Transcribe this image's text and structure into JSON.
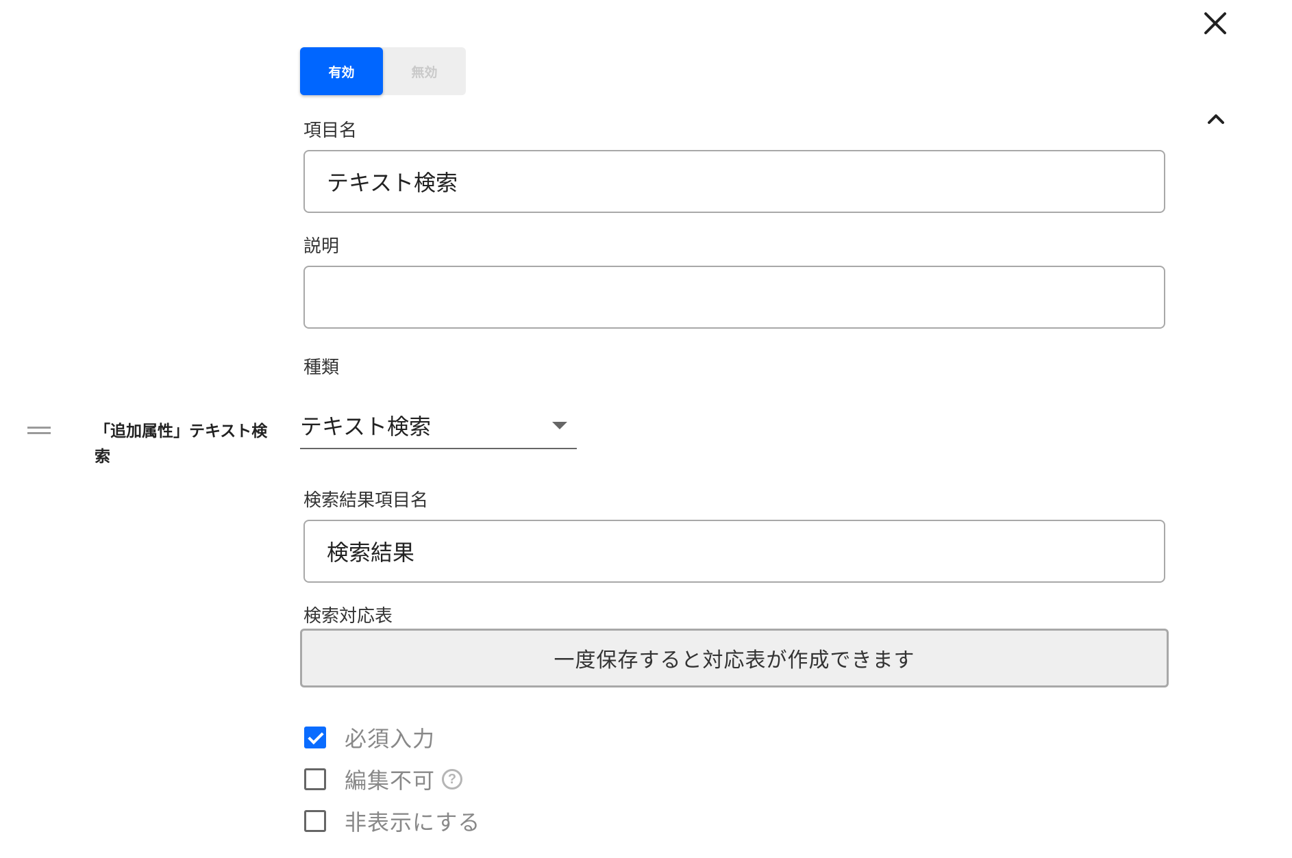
{
  "status_toggle": {
    "enabled_label": "有効",
    "disabled_label": "無効",
    "selected": "enabled"
  },
  "item_name": {
    "label": "項目名",
    "value": "テキスト検索"
  },
  "description": {
    "label": "説明",
    "value": ""
  },
  "type": {
    "label": "種類",
    "selected": "テキスト検索"
  },
  "row": {
    "title": "「追加属性」テキスト検索"
  },
  "result_item_name": {
    "label": "検索結果項目名",
    "value": "検索結果"
  },
  "search_table": {
    "label": "検索対応表",
    "button_text": "一度保存すると対応表が作成できます"
  },
  "options": [
    {
      "label": "必須入力",
      "checked": true
    },
    {
      "label": "編集不可",
      "checked": false,
      "help": "?"
    },
    {
      "label": "非表示にする",
      "checked": false
    }
  ],
  "colors": {
    "accent": "#0066ff",
    "border": "#a8a8a8",
    "muted_text": "#888888"
  },
  "icons": [
    "close-icon",
    "chevron-up-icon",
    "drag-handle-icon",
    "help-icon",
    "dropdown-arrow-icon",
    "check-icon"
  ]
}
